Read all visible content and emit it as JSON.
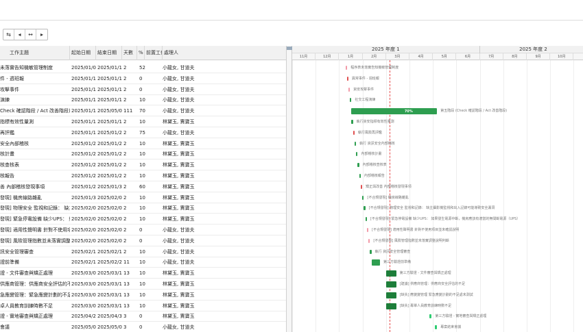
{
  "toolbar": {
    "icons": [
      "indent-icon",
      "prev-icon",
      "expand-icon",
      "next-icon"
    ]
  },
  "columns": [
    "工作主題",
    "起始日期",
    "結束日期",
    "天數",
    "%",
    "前置工作",
    "處理人"
  ],
  "timeline": {
    "years": [
      "2025 年度 1",
      "2025 年度 2"
    ],
    "months": [
      "11月",
      "12月",
      "1月",
      "2月",
      "3月",
      "4月",
      "5月",
      "6月",
      "7月",
      "8月",
      "9月",
      "10月"
    ]
  },
  "rows": [
    {
      "name": "未落實告知機敏管理制度",
      "start": "2025/01/09",
      "end": "2025/01/10",
      "days": "2",
      "pct": "52",
      "owner": "小龍女, 甘道夫",
      "label": "程序表未落實告知機敏管理制度",
      "bar_color": "#f29aa8",
      "s": 9.5,
      "e": 10.5
    },
    {
      "name": "件 - 週班報",
      "start": "2025/01/11",
      "end": "2025/01/12",
      "days": "2",
      "pct": "0",
      "owner": "小龍女, 甘道夫",
      "label": "異常事件 - 週班報",
      "bar_color": "#e05050",
      "s": 11,
      "e": 12
    },
    {
      "name": "攻擊事件",
      "start": "2025/01/13",
      "end": "2025/01/14",
      "days": "2",
      "pct": "0",
      "owner": "小龍女, 甘道夫",
      "label": "資安攻擊事件",
      "bar_color": "#f29aa8",
      "s": 13,
      "e": 14
    },
    {
      "name": "演練",
      "start": "2025/01/15",
      "end": "2025/01/16",
      "days": "2",
      "pct": "10",
      "owner": "小龍女, 甘道夫",
      "label": "社交工程演練",
      "bar_color": "#2e9e50",
      "s": 15,
      "e": 16
    },
    {
      "name": "Check 確認階段 / Act 改善階段)",
      "start": "2025/01/17",
      "end": "2025/05/07",
      "days": "111",
      "pct": "70",
      "owner": "小龍女, 甘道夫",
      "label": "第五階段 (Check 確認階段 / Act 改善階段)",
      "bar_color": "#2e9e50",
      "s": 17,
      "e": 127,
      "thick": true,
      "pct_label": "70%"
    },
    {
      "name": "指標有效性量測",
      "start": "2025/01/17",
      "end": "2025/01/18",
      "days": "2",
      "pct": "10",
      "owner": "林黛玉, 賈寶玉",
      "label": "執行資安指標有效性量測",
      "bar_color": "#2e9e50",
      "s": 17,
      "e": 18
    },
    {
      "name": "再評鑑",
      "start": "2025/01/19",
      "end": "2025/01/20",
      "days": "2",
      "pct": "75",
      "owner": "小龍女, 甘道夫",
      "label": "執行風險再評鑑",
      "bar_color": "#e05050",
      "s": 19,
      "e": 20
    },
    {
      "name": "安全內部稽核",
      "start": "2025/01/21",
      "end": "2025/01/22",
      "days": "2",
      "pct": "10",
      "owner": "林黛玉, 賈寶玉",
      "label": "執行 資訊安全內部稽核",
      "bar_color": "#2e9e50",
      "s": 21,
      "e": 22
    },
    {
      "name": "核計畫",
      "start": "2025/01/23",
      "end": "2025/01/24",
      "days": "2",
      "pct": "10",
      "owner": "林黛玉, 賈寶玉",
      "label": "內部稽核計畫",
      "bar_color": "#2e9e50",
      "s": 23,
      "e": 24
    },
    {
      "name": "核查核表",
      "start": "2025/01/25",
      "end": "2025/01/26",
      "days": "2",
      "pct": "10",
      "owner": "林黛玉, 賈寶玉",
      "label": "內部稽核查核表",
      "bar_color": "#2e9e50",
      "s": 25,
      "e": 26
    },
    {
      "name": "核報告",
      "start": "2025/01/27",
      "end": "2025/01/28",
      "days": "2",
      "pct": "10",
      "owner": "林黛玉, 賈寶玉",
      "label": "內部稽核報告",
      "bar_color": "#2e9e50",
      "s": 27,
      "e": 28
    },
    {
      "name": "善 內部稽核發現事項",
      "start": "2025/01/29",
      "end": "2025/01/30",
      "days": "2",
      "pct": "60",
      "owner": "林黛玉, 賈寶玉",
      "label": "矯正與改善 內部稽核發現事項",
      "bar_color": "#e05050",
      "s": 29,
      "e": 30
    },
    {
      "name": "發現] 機房線路雜亂",
      "start": "2025/01/31",
      "end": "2025/02/01",
      "days": "2",
      "pct": "10",
      "owner": "林黛玉, 賈寶玉",
      "label": "[不合規發現] 機房線路雜亂",
      "bar_color": "#2e9e50",
      "s": 31,
      "e": 32
    },
    {
      "name": "發現] 物理安全 監視和記錄： 缺主",
      "start": "2025/02/02",
      "end": "2025/02/03",
      "days": "2",
      "pct": "10",
      "owner": "林黛玉, 賈寶玉",
      "label": "[不合規發現] 物理安全 監視和記錄： 缺主攝影機監視和出入記錄可能導致安全漏洞",
      "bar_color": "#2e9e50",
      "s": 33,
      "e": 34
    },
    {
      "name": "發現] 緊急停電設備 缺少UPS： 如",
      "start": "2025/02/04",
      "end": "2025/02/05",
      "days": "2",
      "pct": "10",
      "owner": "林黛玉, 賈寶玉",
      "label": "[不合規發現] 緊急停電設備 缺少UPS： 如果發生電源中斷，機房應該有適當的無間斷電源（UPS）",
      "bar_color": "#2e9e50",
      "s": 35,
      "e": 36
    },
    {
      "name": "發現] 適用性聲明書 針對不使用項目",
      "start": "2025/02/06",
      "end": "2025/02/07",
      "days": "2",
      "pct": "0",
      "owner": "小龍女, 甘道夫",
      "label": "[不合規發現] 適用性聲明書 針對不使用項目並未確認說明",
      "bar_color": "#f29aa8",
      "s": 37,
      "e": 38
    },
    {
      "name": "發現] 風險管理指數並未落實調整說",
      "start": "2025/02/08",
      "end": "2025/02/09",
      "days": "2",
      "pct": "0",
      "owner": "小龍女, 甘道夫",
      "label": "[不合規發現] 風險管理指數並未落實調整說明判斷",
      "bar_color": "#f29aa8",
      "s": 39,
      "e": 40
    },
    {
      "name": "訊安全管理審查",
      "start": "2025/02/10",
      "end": "2025/02/11",
      "days": "2",
      "pct": "10",
      "owner": "小龍女, 甘道夫",
      "label": "執行 資訊安全管理審查",
      "bar_color": "#2e9e50",
      "s": 41,
      "e": 42
    },
    {
      "name": "證前準備",
      "start": "2025/02/12",
      "end": "2025/02/22",
      "days": "11",
      "pct": "10",
      "owner": "小龍女, 甘道夫",
      "label": "第三方驗證前準備",
      "bar_color": "#2e9e50",
      "s": 43,
      "e": 53,
      "thick": true
    },
    {
      "name": "證 - 文件審查與矯正處理",
      "start": "2025/03/03",
      "end": "2025/03/15",
      "days": "13",
      "pct": "10",
      "owner": "林黛玉, 賈寶玉",
      "label": "第三方驗證 - 文件審查與矯正處理",
      "bar_color": "#1e7e3a",
      "s": 62,
      "e": 74,
      "thick": true
    },
    {
      "name": "供應商管理：供應商安全評估的不足",
      "start": "2025/03/03",
      "end": "2025/03/15",
      "days": "13",
      "pct": "10",
      "owner": "林黛玉, 賈寶玉",
      "label": "[建議] 供應商管理：供應商安全評估的不足",
      "bar_color": "#1e7e3a",
      "s": 62,
      "e": 74,
      "thick": true
    },
    {
      "name": "急應變管理：緊急應變計劃的不足",
      "start": "2025/03/03",
      "end": "2025/03/15",
      "days": "13",
      "pct": "10",
      "owner": "林黛玉, 賈寶玉",
      "label": "[缺失] 應變變管理 緊急應變計劃的不足處未測試",
      "bar_color": "#1e7e3a",
      "s": 62,
      "e": 74,
      "thick": true
    },
    {
      "name": "卓人員教育訓練時數不足",
      "start": "2025/03/03",
      "end": "2025/03/15",
      "days": "13",
      "pct": "10",
      "owner": "林黛玉, 賈寶玉",
      "label": "[缺失] 專單人員教育訓練時數不足",
      "bar_color": "#1e7e3a",
      "s": 62,
      "e": 74,
      "thick": true
    },
    {
      "name": "證 - 實地審查與矯正處理",
      "start": "2025/04/28",
      "end": "2025/04/30",
      "days": "3",
      "pct": "0",
      "owner": "林黛玉, 賈寶玉",
      "label": "第三方驗證 - 實地審查與矯正處理",
      "bar_color": "#2ecc71",
      "s": 118,
      "e": 120
    },
    {
      "name": "會議",
      "start": "2025/05/05",
      "end": "2025/05/07",
      "days": "3",
      "pct": "0",
      "owner": "小龍女, 甘道夫",
      "label": "專案結束會議",
      "bar_color": "#2ecc71",
      "s": 125,
      "e": 127
    }
  ]
}
